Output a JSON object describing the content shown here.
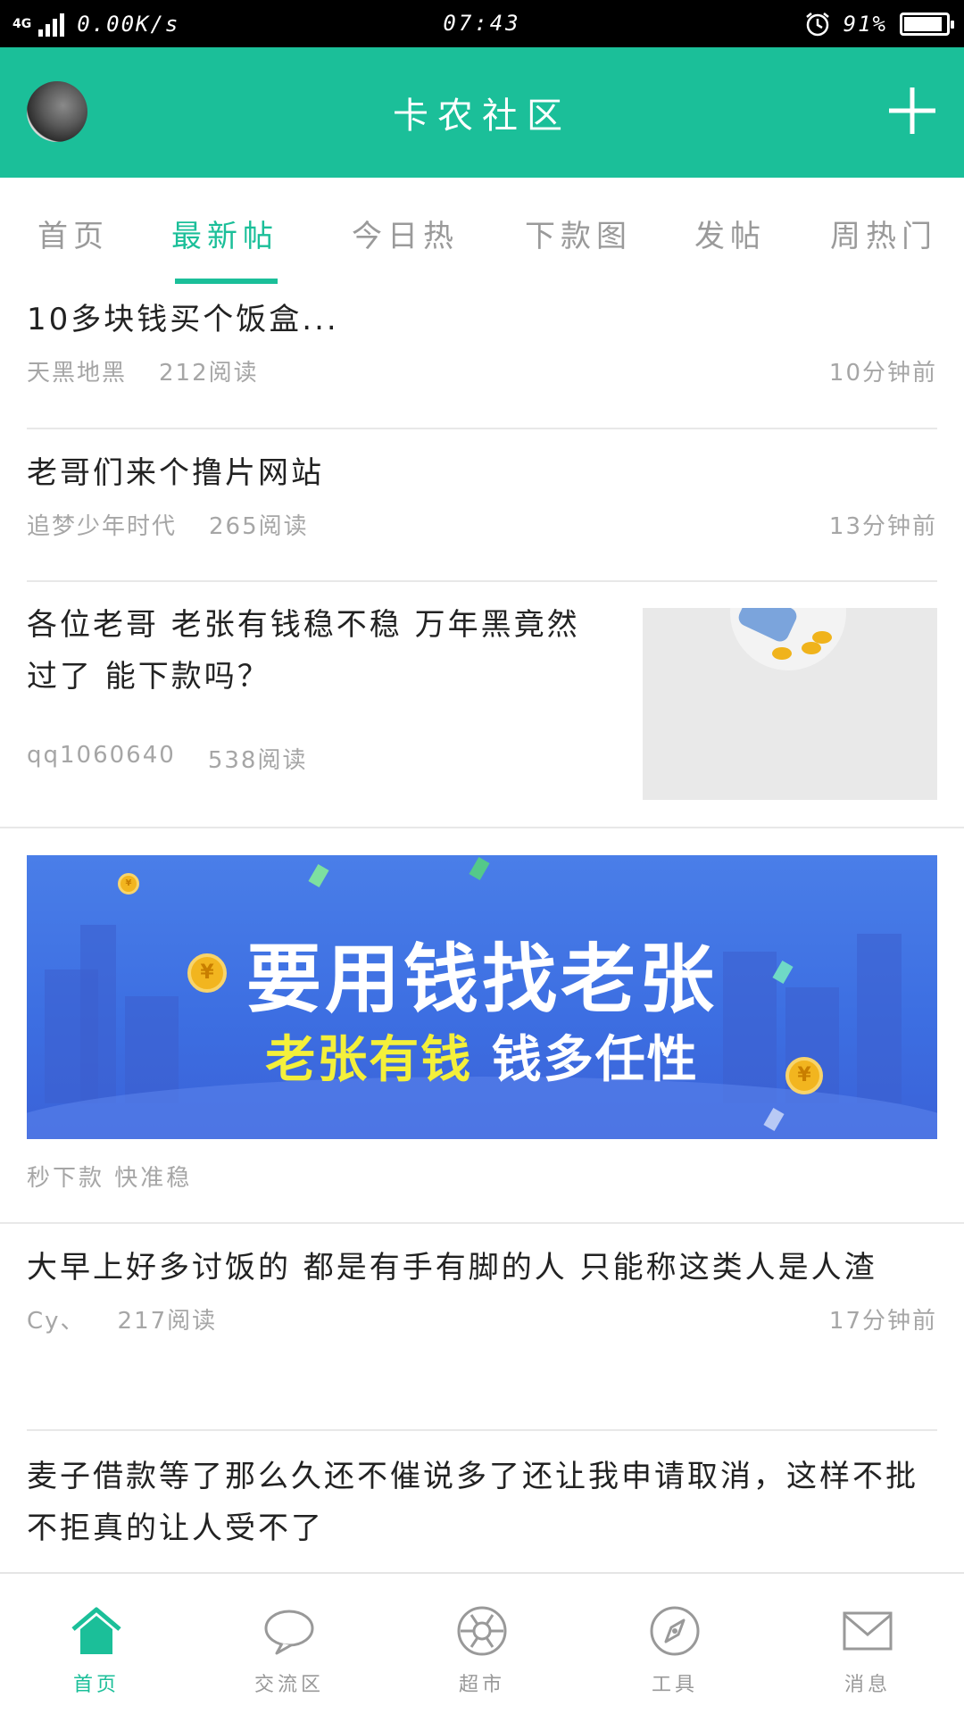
{
  "status_bar": {
    "network": "4G",
    "speed": "0.00K/s",
    "time": "07:43",
    "battery": "91%",
    "battery_level": 0.91
  },
  "header": {
    "title": "卡农社区"
  },
  "tabs": [
    {
      "label": "首页"
    },
    {
      "label": "最新帖"
    },
    {
      "label": "今日热"
    },
    {
      "label": "下款图"
    },
    {
      "label": "发帖"
    },
    {
      "label": "周热门"
    }
  ],
  "active_tab": "最新帖",
  "posts": [
    {
      "title": "10多块钱买个饭盒...",
      "author": "天黑地黑",
      "reads": "212阅读",
      "time": "10分钟前"
    },
    {
      "title": "老哥们来个撸片网站",
      "author": "追梦少年时代",
      "reads": "265阅读",
      "time": "13分钟前"
    },
    {
      "title": "各位老哥 老张有钱稳不稳 万年黑竟然过了 能下款吗？",
      "author": "qq1060640",
      "reads": "538阅读",
      "time": ""
    },
    {
      "title": "大早上好多讨饭的 都是有手有脚的人 只能称这类人是人渣",
      "author": "Cy、",
      "reads": "217阅读",
      "time": "17分钟前"
    },
    {
      "title": "麦子借款等了那么久还不催说多了还让我申请取消，这样不批不拒真的让人受不了",
      "author": "",
      "reads": "",
      "time": ""
    }
  ],
  "ad": {
    "line1": "要用钱找老张",
    "line2_highlight": "老张有钱",
    "line2_rest": "钱多任性",
    "caption": "秒下款 快准稳",
    "coin_symbol": "¥"
  },
  "bottom_nav": [
    {
      "label": "首页",
      "icon": "home-icon"
    },
    {
      "label": "交流区",
      "icon": "chat-bubble-icon"
    },
    {
      "label": "超市",
      "icon": "aperture-icon"
    },
    {
      "label": "工具",
      "icon": "compass-icon"
    },
    {
      "label": "消息",
      "icon": "envelope-icon"
    }
  ],
  "colors": {
    "accent": "#1bbf99",
    "ad_blue": "#3d6fe2",
    "ad_yellow": "#f4f03a"
  }
}
